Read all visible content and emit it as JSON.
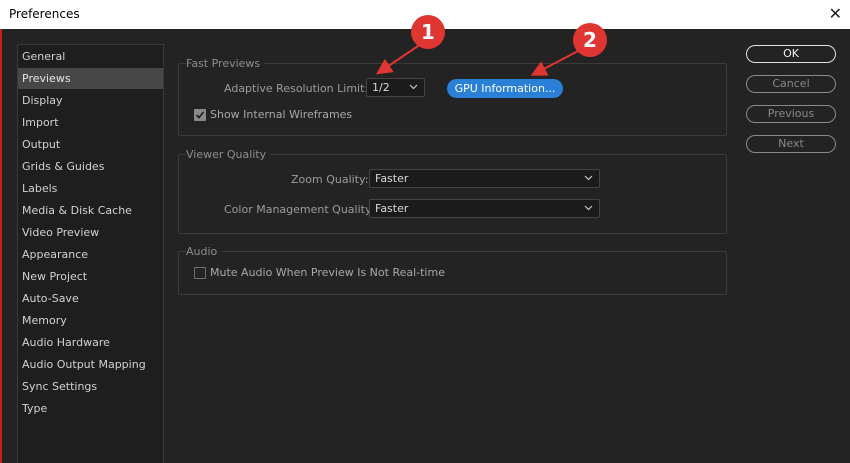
{
  "window": {
    "title": "Preferences"
  },
  "sidebar": {
    "items": [
      {
        "label": "General"
      },
      {
        "label": "Previews",
        "selected": true
      },
      {
        "label": "Display"
      },
      {
        "label": "Import"
      },
      {
        "label": "Output"
      },
      {
        "label": "Grids & Guides"
      },
      {
        "label": "Labels"
      },
      {
        "label": "Media & Disk Cache"
      },
      {
        "label": "Video Preview"
      },
      {
        "label": "Appearance"
      },
      {
        "label": "New Project"
      },
      {
        "label": "Auto-Save"
      },
      {
        "label": "Memory"
      },
      {
        "label": "Audio Hardware"
      },
      {
        "label": "Audio Output Mapping"
      },
      {
        "label": "Sync Settings"
      },
      {
        "label": "Type"
      }
    ]
  },
  "fast_previews": {
    "title": "Fast Previews",
    "adaptive_label": "Adaptive Resolution Limit:",
    "adaptive_value": "1/2",
    "gpu_button": "GPU Information...",
    "wireframes_label": "Show Internal Wireframes",
    "wireframes_checked": true
  },
  "viewer_quality": {
    "title": "Viewer Quality",
    "zoom_label": "Zoom Quality:",
    "zoom_value": "Faster",
    "color_label": "Color Management Quality:",
    "color_value": "Faster"
  },
  "audio": {
    "title": "Audio",
    "mute_label": "Mute Audio When Preview Is Not Real-time",
    "mute_checked": false
  },
  "buttons": {
    "ok": "OK",
    "cancel": "Cancel",
    "previous": "Previous",
    "next": "Next"
  },
  "annotations": {
    "one": "1",
    "two": "2"
  },
  "colors": {
    "accent": "#2a7fd6",
    "annotation": "#e03631"
  }
}
